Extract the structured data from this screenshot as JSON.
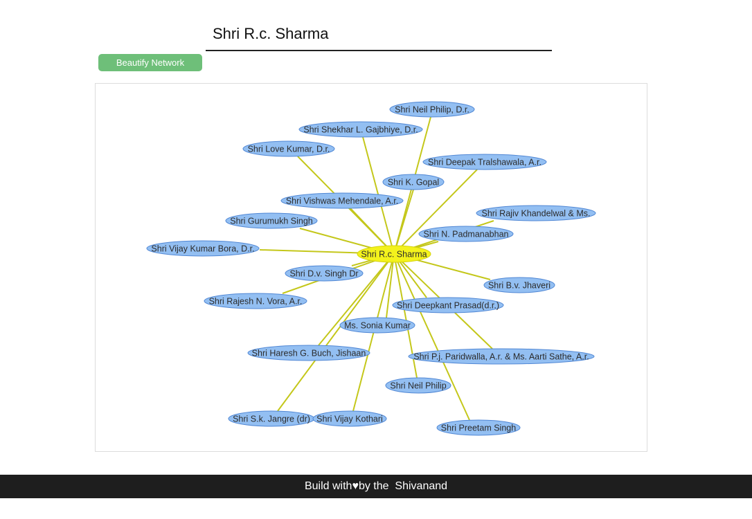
{
  "search": {
    "value": "Shri R.c. Sharma"
  },
  "toolbar": {
    "beautify_label": "Beautify Network"
  },
  "graph": {
    "center": {
      "label": "Shri R.c. Sharma"
    },
    "nodes": [
      {
        "id": "n1",
        "label": "Shri Neil Philip, D.r."
      },
      {
        "id": "n2",
        "label": "Shri Shekhar L. Gajbhiye, D.r."
      },
      {
        "id": "n3",
        "label": "Shri Love Kumar, D.r."
      },
      {
        "id": "n4",
        "label": "Shri Deepak Tralshawala, A.r."
      },
      {
        "id": "n5",
        "label": "Shri K. Gopal"
      },
      {
        "id": "n6",
        "label": "Shri Vishwas Mehendale, A.r."
      },
      {
        "id": "n7",
        "label": "Shri Gurumukh Singh"
      },
      {
        "id": "n8",
        "label": "Shri Rajiv Khandelwal & Ms."
      },
      {
        "id": "n9",
        "label": "Shri N. Padmanabhan"
      },
      {
        "id": "n10",
        "label": "Shri Vijay Kumar Bora, D.r."
      },
      {
        "id": "n11",
        "label": "Shri D.v. Singh Dr"
      },
      {
        "id": "n12",
        "label": "Shri B.v. Jhaveri"
      },
      {
        "id": "n13",
        "label": "Shri Rajesh N. Vora, A.r."
      },
      {
        "id": "n14",
        "label": "Shri Deepkant Prasad(d.r.)"
      },
      {
        "id": "n15",
        "label": "Ms. Sonia Kumar"
      },
      {
        "id": "n16",
        "label": "Shri Haresh G. Buch, Jishaan"
      },
      {
        "id": "n17",
        "label": "Shri P.j. Paridwalla, A.r. & Ms. Aarti Sathe, A.r."
      },
      {
        "id": "n18",
        "label": "Shri Neil Philip"
      },
      {
        "id": "n19",
        "label": "Shri S.k. Jangre (dr)"
      },
      {
        "id": "n20",
        "label": "Shri Vijay Kothari"
      },
      {
        "id": "n21",
        "label": "Shri Preetam Singh"
      }
    ],
    "colors": {
      "node_fill": "#93bff2",
      "node_stroke": "#4f86d4",
      "center_fill": "#f3f21c",
      "edge": "#c4c71a"
    }
  },
  "footer": {
    "prefix": "Build with",
    "heart": "♥",
    "suffix": "by the  Shivanand"
  }
}
